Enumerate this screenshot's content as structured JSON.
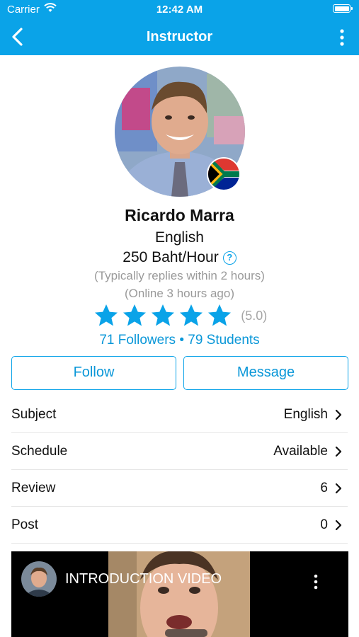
{
  "status_bar": {
    "carrier": "Carrier",
    "time": "12:42 AM"
  },
  "nav": {
    "title": "Instructor"
  },
  "profile": {
    "name": "Ricardo Marra",
    "subject": "English",
    "price": "250 Baht/Hour",
    "reply_note": "(Typically replies within 2 hours)",
    "online_note": "(Online 3 hours ago)",
    "rating": 5,
    "rating_text": "(5.0)",
    "followers_line": "71 Followers • 79 Students",
    "flag": "south-africa-flag"
  },
  "actions": {
    "follow_label": "Follow",
    "message_label": "Message"
  },
  "rows": [
    {
      "label": "Subject",
      "value": "English"
    },
    {
      "label": "Schedule",
      "value": "Available"
    },
    {
      "label": "Review",
      "value": "6"
    },
    {
      "label": "Post",
      "value": "0"
    }
  ],
  "video": {
    "title": "INTRODUCTION VIDEO"
  },
  "colors": {
    "accent": "#0aa3e8",
    "star": "#0aa3e8",
    "gray_text": "#9a9a9a"
  }
}
